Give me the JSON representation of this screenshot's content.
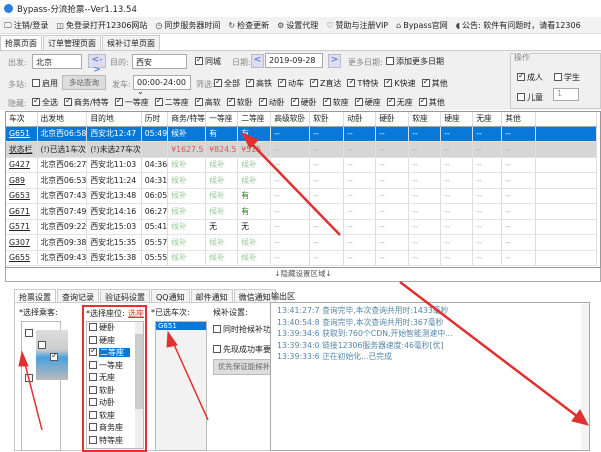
{
  "window": {
    "title": "Bypass-分流抢票--Ver1.13.54"
  },
  "toolbar": [
    "注销/登录",
    "免登录打开12306网站",
    "同步服务器时间",
    "检查更新",
    "设置代理",
    "赞助与注册VIP",
    "Bypass官网",
    "公告: 软件有问题时，请看12306"
  ],
  "toolbar_icons": [
    "monitor-icon",
    "window-icon",
    "clock-icon",
    "refresh-icon",
    "gear-icon",
    "heart-icon",
    "home-icon",
    "speaker-icon"
  ],
  "tabs": [
    "抢票页面",
    "订单管理页面",
    "候补订单页面"
  ],
  "form": {
    "from_label": "出发:",
    "from": "北京",
    "swap": "<->",
    "to_label": "目的:",
    "to": "西安",
    "same_city": "同城",
    "date_label": "日期:",
    "date": "2019-09-28",
    "prev": "<",
    "next": ">",
    "more_dates_label": "更多日期:",
    "add_dates": "添加更多日期",
    "multi_label": "多站:",
    "enable": "启用",
    "multi_query": "多站查询",
    "depart_label": "发车:",
    "time_range": "00:00-24:00",
    "filter_label": "筛选:",
    "filters": [
      "全部",
      "高铁",
      "动车",
      "Z直达",
      "T特快",
      "K快速",
      "其他"
    ],
    "hide_label": "隐藏:",
    "hides": [
      "全选",
      "商务/特等",
      "一等座",
      "二等座",
      "高软",
      "软卧",
      "动卧",
      "硬卧",
      "软座",
      "硬座",
      "无座",
      "其他"
    ],
    "op_label": "操作",
    "adult": "成人",
    "student": "学生",
    "child": "儿童",
    "child_count": "1"
  },
  "table": {
    "headers": [
      "车次",
      "出发地",
      "目的地",
      "历时",
      "商务/特等",
      "一等座",
      "二等座",
      "高级软卧",
      "软卧",
      "动卧",
      "硬卧",
      "软座",
      "硬座",
      "无座",
      "其他"
    ],
    "rows": [
      [
        "G651",
        "北京西06:58",
        "西安北12:47",
        "05:49",
        "候补",
        "有",
        "有",
        "--",
        "--",
        "--",
        "--",
        "--",
        "--",
        "--",
        "--"
      ],
      [
        "状态栏",
        "(!)已选1车次",
        "(!)未选27车次",
        "",
        "¥1627.5",
        "¥824.5",
        "¥515",
        "--",
        "--",
        "--",
        "--",
        "--",
        "--",
        "--",
        "--"
      ],
      [
        "G427",
        "北京西06:27",
        "西安北11:03",
        "04:36",
        "候补",
        "候补",
        "候补",
        "--",
        "--",
        "--",
        "--",
        "--",
        "--",
        "--",
        "--"
      ],
      [
        "G89",
        "北京西06:53",
        "西安北11:24",
        "04:31",
        "候补",
        "候补",
        "候补",
        "--",
        "--",
        "--",
        "--",
        "--",
        "--",
        "--",
        "--"
      ],
      [
        "G653",
        "北京西07:43",
        "西安北13:48",
        "06:05",
        "候补",
        "候补",
        "有",
        "--",
        "--",
        "--",
        "--",
        "--",
        "--",
        "--",
        "--"
      ],
      [
        "G671",
        "北京西07:49",
        "西安北14:16",
        "06:27",
        "候补",
        "候补",
        "有",
        "--",
        "--",
        "--",
        "--",
        "--",
        "--",
        "--",
        "--"
      ],
      [
        "G571",
        "北京西09:22",
        "西安北15:03",
        "05:41",
        "候补",
        "无",
        "无",
        "--",
        "--",
        "--",
        "--",
        "--",
        "--",
        "--",
        "--"
      ],
      [
        "G307",
        "北京西09:38",
        "西安北15:35",
        "05:57",
        "候补",
        "候补",
        "候补",
        "--",
        "--",
        "--",
        "--",
        "--",
        "--",
        "--",
        "--"
      ],
      [
        "G655",
        "北京西09:43",
        "西安北15:38",
        "05:55",
        "候补",
        "候补",
        "候补",
        "--",
        "--",
        "--",
        "--",
        "--",
        "--",
        "--",
        "--"
      ]
    ]
  },
  "hide_area": "↓隐藏设置区域↓",
  "bottom_tabs": [
    "抢票设置",
    "查询记录",
    "验证码设置",
    "QQ通知",
    "邮件通知",
    "微信通知"
  ],
  "passengers_label": "*选择乘客:",
  "seat_label": "*选择座位:",
  "seat_link": "选座",
  "seats": [
    [
      "硬卧",
      false
    ],
    [
      "硬座",
      false
    ],
    [
      "二等座",
      true
    ],
    [
      "一等座",
      false
    ],
    [
      "无座",
      false
    ],
    [
      "软卧",
      false
    ],
    [
      "动卧",
      false
    ],
    [
      "软座",
      false
    ],
    [
      "商务座",
      false
    ],
    [
      "特等座",
      false
    ]
  ],
  "selected_trains_label": "*已选车次:",
  "selected_trains": [
    "G651"
  ],
  "waitlist_label": "候补设置:",
  "waitlist_opts": [
    "同时抢候补功能",
    "先现成功率要求"
  ],
  "waitlist_select": "优先保证能候补",
  "output_label": "输出区",
  "output": [
    "13:41:27:7  查询完毕,本次查询共用时:1433毫秒",
    "13:40:54:8  查询完毕,本次查询共用时:367毫秒",
    "13:39:34:6  获取到:760个CDN,开始智能测速中...",
    "13:39:34:0  链接12306服务器速度:46毫秒[优]",
    "13:39:33:6  正在初始化...已完成"
  ],
  "colors": {
    "selected_row": "#0a78d7",
    "annotation_arrow": "#e03030"
  }
}
